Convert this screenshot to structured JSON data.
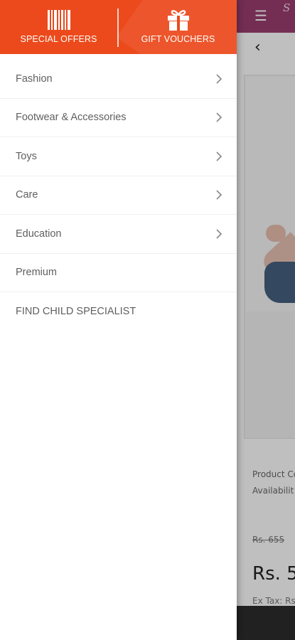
{
  "background": {
    "logo_text": "S",
    "product_code_label": "Product Co",
    "availability_label": "Availabilit",
    "old_price": "Rs. 655",
    "price": "Rs. 5",
    "ex_tax": "Ex Tax: Rs."
  },
  "drawer": {
    "header": {
      "special_offers_label": "SPECIAL OFFERS",
      "gift_vouchers_label": "GIFT VOUCHERS",
      "special_offers_icon": "barcode-icon",
      "gift_vouchers_icon": "gift-icon"
    },
    "menu": [
      {
        "label": "Fashion",
        "has_submenu": true
      },
      {
        "label": "Footwear & Accessories",
        "has_submenu": true
      },
      {
        "label": "Toys",
        "has_submenu": true
      },
      {
        "label": "Care",
        "has_submenu": true
      },
      {
        "label": "Education",
        "has_submenu": true
      },
      {
        "label": "Premium",
        "has_submenu": false
      },
      {
        "label": "FIND CHILD SPECIALIST",
        "has_submenu": false
      }
    ]
  },
  "colors": {
    "header_orange": "#ec4a1c",
    "app_bar_purple": "#9b3e6f",
    "menu_text": "#5f5f5f"
  }
}
